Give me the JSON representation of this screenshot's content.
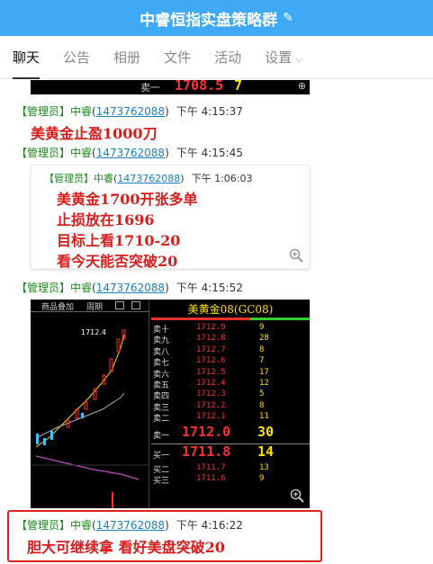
{
  "header": {
    "title": "中睿恒指实盘策略群",
    "edit_icon": "edit-icon"
  },
  "tabs": [
    {
      "label": "聊天",
      "active": true
    },
    {
      "label": "公告"
    },
    {
      "label": "相册"
    },
    {
      "label": "文件"
    },
    {
      "label": "活动"
    },
    {
      "label": "设置"
    }
  ],
  "top_snippet": {
    "row_label": "卖一",
    "price": "1708.5",
    "vol": "7"
  },
  "messages": [
    {
      "role": "【管理员】",
      "name": "中睿",
      "qq": "1473762088",
      "time": "下午 4:15:37",
      "text": "美黄金止盈1000刀"
    },
    {
      "role": "【管理员】",
      "name": "中睿",
      "qq": "1473762088",
      "time": "下午 4:15:45",
      "quote": {
        "role": "【管理员】",
        "name": "中睿",
        "qq": "1473762088",
        "time": "下午 1:06:03",
        "lines": [
          "美黄金1700开张多单",
          "止损放在1696",
          "目标上看1710-20",
          "看今天能否突破20"
        ]
      }
    },
    {
      "role": "【管理员】",
      "name": "中睿",
      "qq": "1473762088",
      "time": "下午 4:15:52"
    },
    {
      "role": "【管理员】",
      "name": "中睿",
      "qq": "1473762088",
      "time": "下午 4:16:22",
      "text": "胆大可继续拿 看好美盘突破20"
    }
  ],
  "quote_panel": {
    "toolbar": [
      "商品叠加",
      "周期"
    ],
    "price_label": "1712.4",
    "title": "美黄金08(GC08)",
    "rows": [
      {
        "label": "卖十",
        "price": "1712.9",
        "vol": "9"
      },
      {
        "label": "卖九",
        "price": "1712.8",
        "vol": "28"
      },
      {
        "label": "卖八",
        "price": "1712.7",
        "vol": "8"
      },
      {
        "label": "卖七",
        "price": "1712.6",
        "vol": "7"
      },
      {
        "label": "卖六",
        "price": "1712.5",
        "vol": "17"
      },
      {
        "label": "卖五",
        "price": "1712.4",
        "vol": "12"
      },
      {
        "label": "卖四",
        "price": "1712.3",
        "vol": "5"
      },
      {
        "label": "卖三",
        "price": "1712.2",
        "vol": "8"
      },
      {
        "label": "卖二",
        "price": "1712.1",
        "vol": "11"
      },
      {
        "label": "卖一",
        "price": "1712.0",
        "vol": "30",
        "big": true
      },
      {
        "label": "买一",
        "price": "1711.8",
        "vol": "14",
        "big": true
      },
      {
        "label": "买二",
        "price": "1711.7",
        "vol": "13"
      },
      {
        "label": "买三",
        "price": "1711.6",
        "vol": "9"
      }
    ]
  }
}
